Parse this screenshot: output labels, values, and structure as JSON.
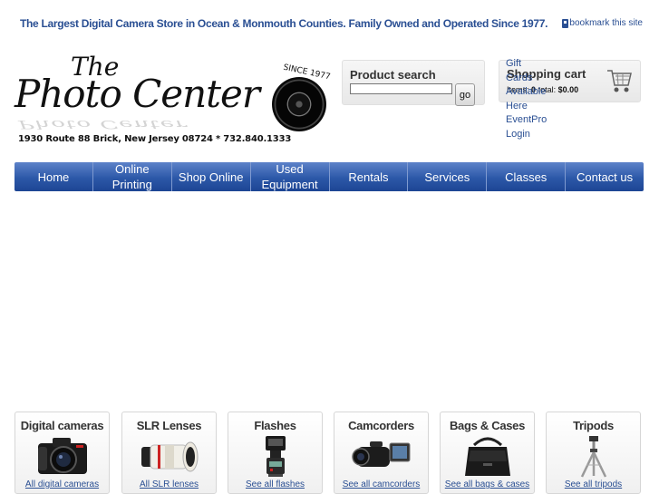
{
  "header": {
    "tagline": "The Largest Digital Camera Store in Ocean & Monmouth Counties.  Family Owned and Operated Since 1977.",
    "bookmark_label": "bookmark this site"
  },
  "logo": {
    "the": "The",
    "main": "Photo Center",
    "since": "SINCE 1977",
    "address": "1930 Route 88 Brick, New Jersey 08724 * 732.840.1333"
  },
  "search": {
    "title": "Product search",
    "value": "",
    "placeholder": "",
    "go_label": "go"
  },
  "cart": {
    "title": "Shopping cart",
    "items_label": "Items:",
    "items_count": "0",
    "total_label": "total:",
    "total_value": "$0.00"
  },
  "side_links": [
    "Gift",
    "Cards",
    "Available",
    "Here",
    "EventPro",
    "Login"
  ],
  "nav": {
    "items": [
      {
        "label": "Home"
      },
      {
        "label": "Online Printing"
      },
      {
        "label": "Shop Online"
      },
      {
        "label": "Used Equipment"
      },
      {
        "label": "Rentals"
      },
      {
        "label": "Services"
      },
      {
        "label": "Classes"
      },
      {
        "label": "Contact us"
      }
    ]
  },
  "products": [
    {
      "title": "Digital cameras",
      "link": "All digital cameras",
      "icon": "dslr-camera-icon"
    },
    {
      "title": "SLR Lenses",
      "link": "All SLR lenses",
      "icon": "telephoto-lens-icon"
    },
    {
      "title": "Flashes",
      "link": "See all flashes",
      "icon": "camera-flash-icon"
    },
    {
      "title": "Camcorders",
      "link": "See all camcorders",
      "icon": "camcorder-icon"
    },
    {
      "title": "Bags & Cases",
      "link": "See all bags & cases",
      "icon": "camera-bag-icon"
    },
    {
      "title": "Tripods",
      "link": "See all tripods",
      "icon": "tripod-icon"
    }
  ],
  "colors": {
    "link_blue": "#2a4f93",
    "nav_blue": "#2c58a8"
  }
}
